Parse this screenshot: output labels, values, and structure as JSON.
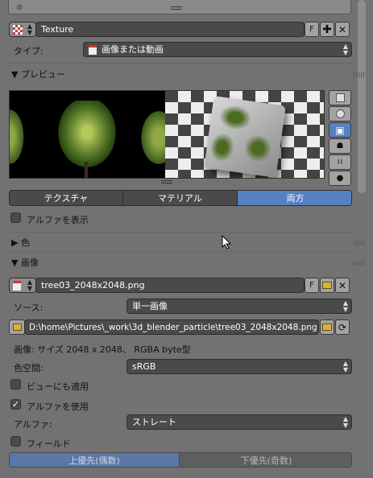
{
  "texture_slot": {
    "name": "Texture",
    "f_label": "F"
  },
  "type_row": {
    "label": "タイプ:",
    "value": "画像または動画"
  },
  "preview": {
    "title": "プレビュー",
    "tabs": [
      "テクスチャ",
      "マテリアル",
      "両方"
    ],
    "active_tab": "両方",
    "show_alpha_label": "アルファを表示"
  },
  "color_panel": {
    "title": "色"
  },
  "image_panel": {
    "title": "画像",
    "image_name": "tree03_2048x2048.png",
    "f_label": "F",
    "source_label": "ソース:",
    "source_value": "単一画像",
    "filepath": "D:\\home\\Pictures\\_work\\3d_blender_particle\\tree03_2048x2048.png",
    "info": "画像: サイズ 2048 x 2048、 RGBA byte型",
    "colorspace_label": "色空間:",
    "colorspace_value": "sRGB",
    "view_as_render_label": "ビューにも適用",
    "use_alpha_label": "アルファを使用",
    "alpha_label": "アルファ:",
    "alpha_value": "ストレート",
    "fields_label": "フィールド",
    "field_order": [
      "上優先(偶数)",
      "下優先(奇数)"
    ],
    "active_field_order": "上優先(偶数)"
  },
  "colors": {
    "active_blue": "#5680c2",
    "panel_bg": "#727272",
    "field_bg": "#4a4a4a"
  }
}
